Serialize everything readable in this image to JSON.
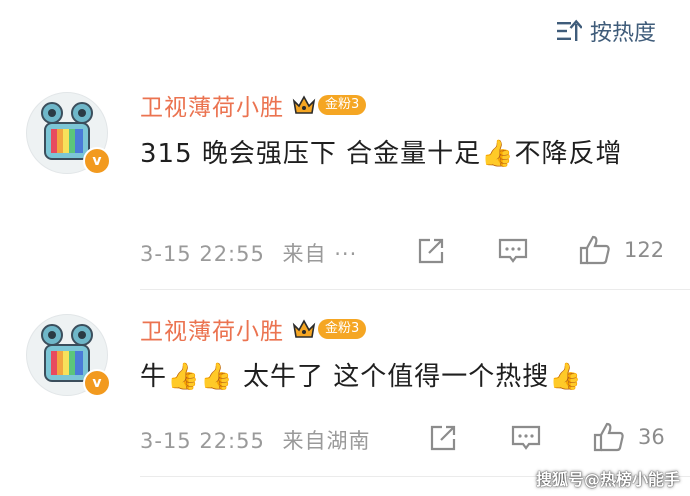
{
  "sort": {
    "label": "按热度",
    "icon": "sort-icon"
  },
  "comments": [
    {
      "username": "卫视薄荷小胜",
      "fan_badge": "金粉3",
      "text": "315 晚会强压下 合金量十足👍不降反增",
      "time": "3-15 22:55",
      "source": "来自 ···",
      "likes": "122"
    },
    {
      "username": "卫视薄荷小胜",
      "fan_badge": "金粉3",
      "text": "牛👍👍 太牛了 这个值得一个热搜👍",
      "time": "3-15 22:55",
      "source": "来自湖南",
      "likes": "36"
    }
  ],
  "watermark": "搜狐号@热榜小能手",
  "colors": {
    "username": "#eb7350",
    "badge": "#f5a623",
    "sort": "#3f5c7a",
    "meta": "#9a9a9a"
  }
}
